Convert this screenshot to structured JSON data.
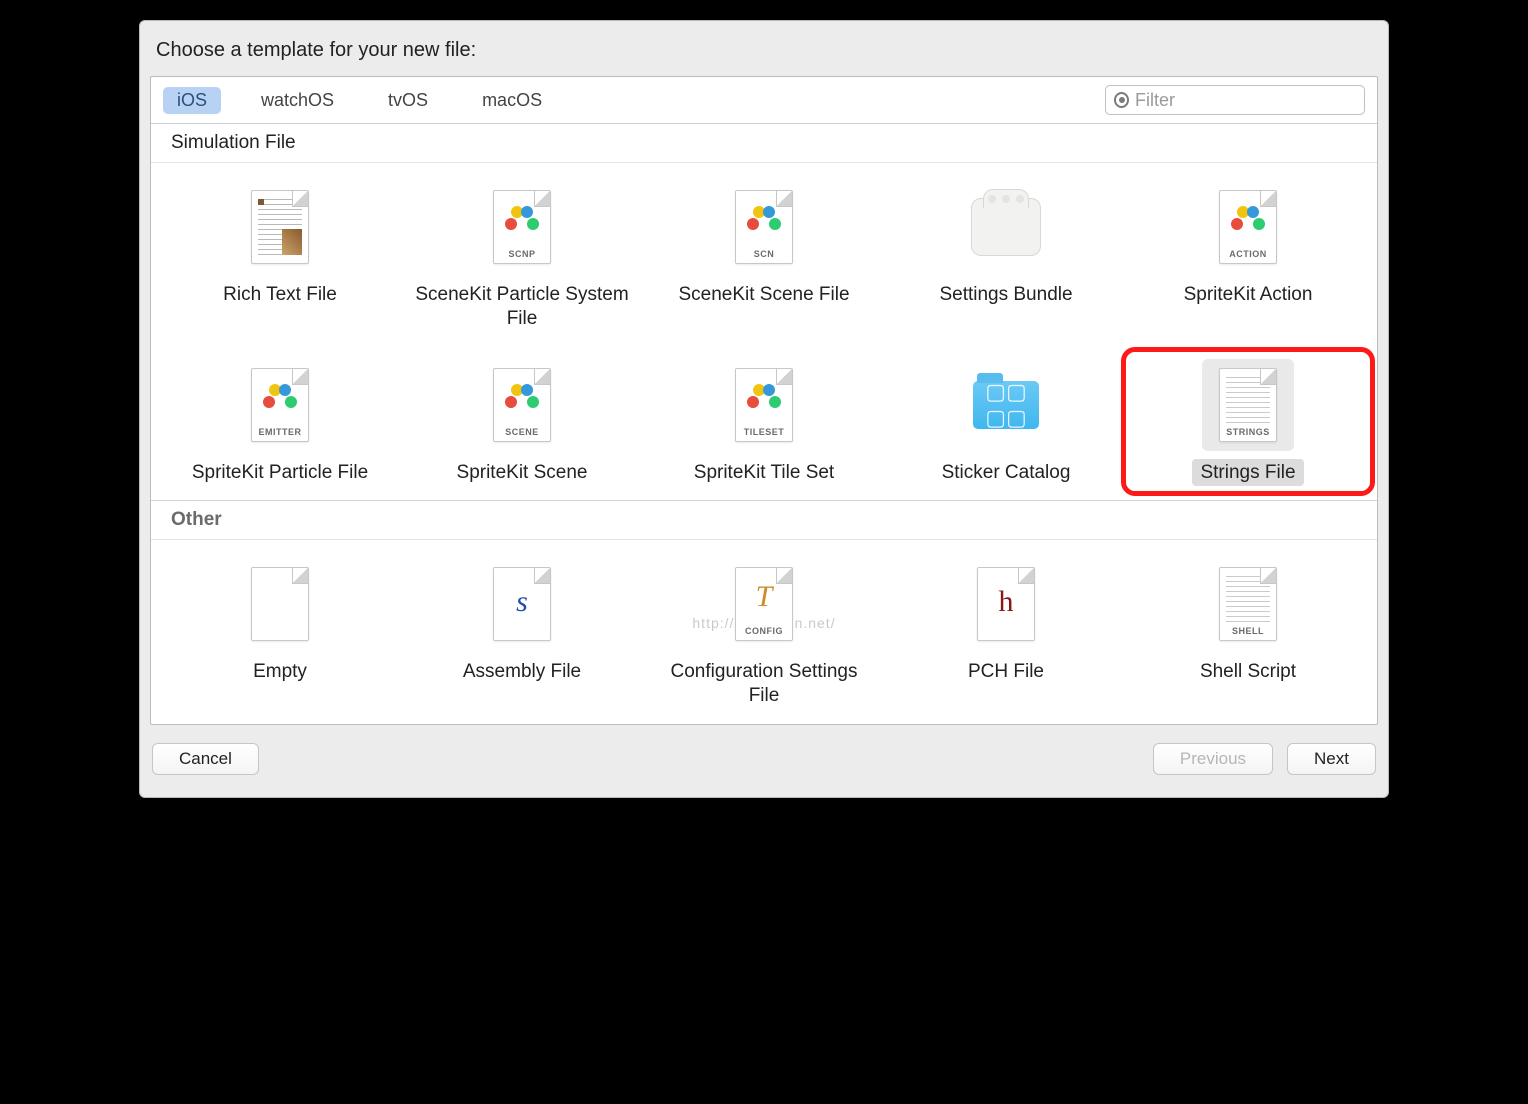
{
  "title": "Choose a template for your new file:",
  "platforms": [
    "iOS",
    "watchOS",
    "tvOS",
    "macOS"
  ],
  "active_platform_index": 0,
  "filter_placeholder": "Filter",
  "sections": [
    {
      "name": "Simulation File",
      "items": [
        {
          "label": "Rich Text File",
          "icon": "rtf",
          "selected": false
        },
        {
          "label": "SceneKit Particle System File",
          "icon": "scnp",
          "selected": false
        },
        {
          "label": "SceneKit Scene File",
          "icon": "scn",
          "selected": false
        },
        {
          "label": "Settings Bundle",
          "icon": "bundle",
          "selected": false
        },
        {
          "label": "SpriteKit Action",
          "icon": "action",
          "selected": false
        },
        {
          "label": "SpriteKit Particle File",
          "icon": "emitter",
          "selected": false
        },
        {
          "label": "SpriteKit Scene",
          "icon": "scene",
          "selected": false
        },
        {
          "label": "SpriteKit Tile Set",
          "icon": "tileset",
          "selected": false
        },
        {
          "label": "Sticker Catalog",
          "icon": "folder",
          "selected": false
        },
        {
          "label": "Strings File",
          "icon": "strings",
          "selected": true,
          "highlighted": true
        }
      ]
    },
    {
      "name": "Other",
      "items": [
        {
          "label": "Empty",
          "icon": "blank",
          "selected": false
        },
        {
          "label": "Assembly File",
          "icon": "s",
          "selected": false
        },
        {
          "label": "Configuration Settings File",
          "icon": "config",
          "selected": false
        },
        {
          "label": "PCH File",
          "icon": "h",
          "selected": false
        },
        {
          "label": "Shell Script",
          "icon": "shell",
          "selected": false
        }
      ]
    }
  ],
  "buttons": {
    "cancel": "Cancel",
    "previous": "Previous",
    "next": "Next"
  },
  "watermark": "http://blog.csdn.net/"
}
